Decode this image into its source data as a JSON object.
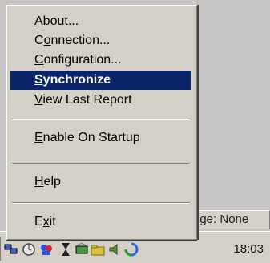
{
  "status_bar": {
    "text": "age: None"
  },
  "menu": {
    "items": [
      {
        "label_pre": "",
        "mnemonic": "A",
        "label_post": "bout...",
        "selected": false
      },
      {
        "label_pre": "C",
        "mnemonic": "o",
        "label_post": "nnection...",
        "selected": false
      },
      {
        "label_pre": "",
        "mnemonic": "C",
        "label_post": "onfiguration...",
        "selected": false
      },
      {
        "label_pre": "",
        "mnemonic": "S",
        "label_post": "ynchronize",
        "selected": true
      },
      {
        "label_pre": "",
        "mnemonic": "V",
        "label_post": "iew Last Report",
        "selected": false
      },
      {
        "label_pre": "",
        "mnemonic": "E",
        "label_post": "nable On Startup",
        "selected": false
      },
      {
        "label_pre": "",
        "mnemonic": "H",
        "label_post": "elp",
        "selected": false
      },
      {
        "label_pre": "E",
        "mnemonic": "x",
        "label_post": "it",
        "selected": false
      }
    ]
  },
  "tray": {
    "clock": "18:03",
    "icons": [
      "network-icon",
      "clock-icon",
      "messenger-icon",
      "hourglass-icon",
      "sync-icon",
      "folder-icon",
      "speaker-icon",
      "refresh-icon"
    ]
  },
  "colors": {
    "highlight": "#0a246a",
    "menu_bg": "#d4d0c8"
  }
}
